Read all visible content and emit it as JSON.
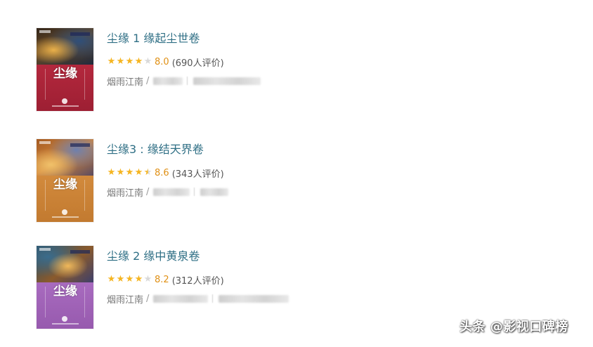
{
  "books": [
    {
      "cover_title": "尘缘",
      "title": "尘缘 1 缘起尘世卷",
      "stars": [
        "full",
        "full",
        "full",
        "full",
        "empty"
      ],
      "score": "8.0",
      "votes": "(690人评价)",
      "author": "烟雨江南",
      "separator": "/",
      "cover_color": "#b4283d"
    },
    {
      "cover_title": "尘缘",
      "title": "尘缘3 : 缘结天界卷",
      "stars": [
        "full",
        "full",
        "full",
        "full",
        "half"
      ],
      "score": "8.6",
      "votes": "(343人评价)",
      "author": "烟雨江南",
      "separator": "/",
      "cover_color": "#d28a3c"
    },
    {
      "cover_title": "尘缘",
      "title": "尘缘 2 缘中黄泉卷",
      "stars": [
        "full",
        "full",
        "full",
        "full",
        "empty"
      ],
      "score": "8.2",
      "votes": "(312人评价)",
      "author": "烟雨江南",
      "separator": "/",
      "cover_color": "#a86bbf"
    }
  ],
  "watermark": "头条 @影视口碑榜",
  "colors": {
    "title_link": "#2f6f85",
    "star": "#f5b521",
    "score": "#e09015"
  }
}
